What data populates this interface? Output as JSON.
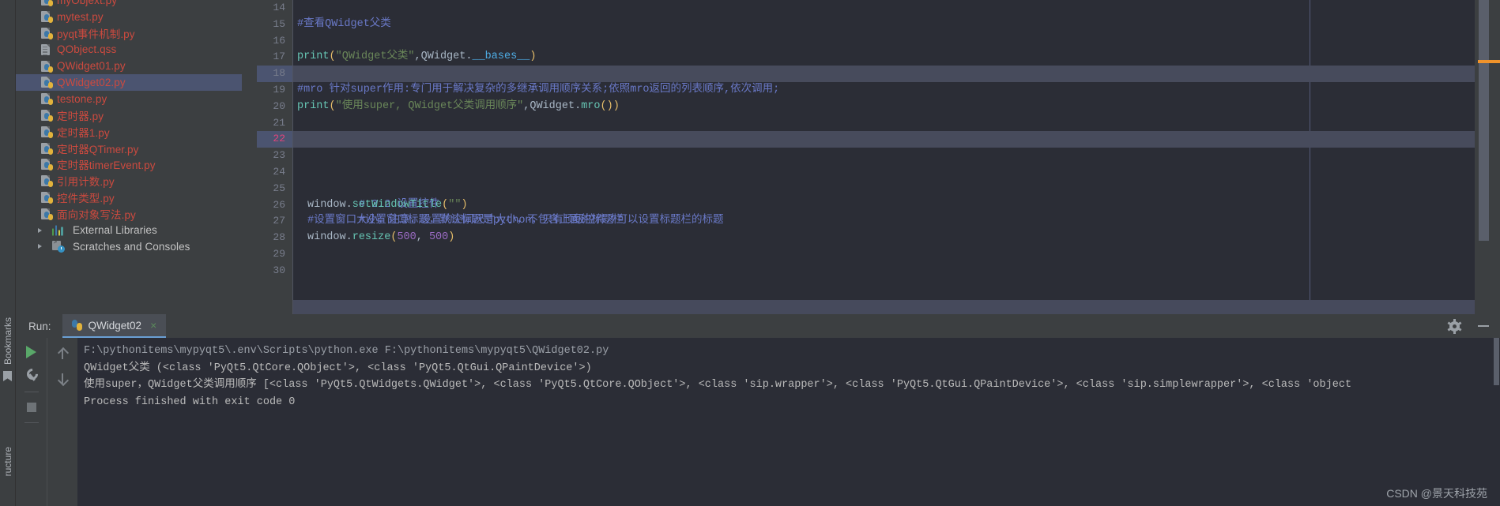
{
  "sidebar": {
    "files": [
      {
        "label": "myObjext.py",
        "icon": "python-file-icon",
        "type": "py",
        "selected": false,
        "partial": true
      },
      {
        "label": "mytest.py",
        "icon": "python-file-icon",
        "type": "py",
        "selected": false
      },
      {
        "label": "pyqt事件机制.py",
        "icon": "python-file-icon",
        "type": "py",
        "selected": false
      },
      {
        "label": "QObject.qss",
        "icon": "qss-file-icon",
        "type": "qss",
        "selected": false
      },
      {
        "label": "QWidget01.py",
        "icon": "python-file-icon",
        "type": "py",
        "selected": false
      },
      {
        "label": "QWidget02.py",
        "icon": "python-file-icon",
        "type": "py",
        "selected": true
      },
      {
        "label": "testone.py",
        "icon": "python-file-icon",
        "type": "py",
        "selected": false
      },
      {
        "label": "定时器.py",
        "icon": "python-file-icon",
        "type": "py",
        "selected": false
      },
      {
        "label": "定时器1.py",
        "icon": "python-file-icon",
        "type": "py",
        "selected": false
      },
      {
        "label": "定时器QTimer.py",
        "icon": "python-file-icon",
        "type": "py",
        "selected": false
      },
      {
        "label": "定时器timerEvent.py",
        "icon": "python-file-icon",
        "type": "py",
        "selected": false
      },
      {
        "label": "引用计数.py",
        "icon": "python-file-icon",
        "type": "py",
        "selected": false
      },
      {
        "label": "控件类型.py",
        "icon": "python-file-icon",
        "type": "py",
        "selected": false
      },
      {
        "label": "面向对象写法.py",
        "icon": "python-file-icon",
        "type": "py",
        "selected": false
      }
    ],
    "nodes": [
      {
        "label": "External Libraries",
        "icon": "libraries-icon"
      },
      {
        "label": "Scratches and Consoles",
        "icon": "scratches-icon"
      }
    ]
  },
  "editor": {
    "line_numbers": [
      "14",
      "15",
      "16",
      "17",
      "18",
      "19",
      "20",
      "21",
      "22",
      "23",
      "24",
      "25",
      "26",
      "27",
      "28",
      "29",
      "30"
    ],
    "current_line": "22",
    "highlighted_lines": [
      "18",
      "22"
    ],
    "lines": [
      {
        "n": "14",
        "text": ""
      },
      {
        "n": "15",
        "text": "#查看QWidget父类"
      },
      {
        "n": "16",
        "text": ""
      },
      {
        "n": "17",
        "text": "print(\"QWidget父类\",QWidget.__bases__)"
      },
      {
        "n": "18",
        "text": ""
      },
      {
        "n": "19",
        "text": "#mro 针对super作用:专门用于解决复杂的多继承调用顺序关系;依照mro返回的列表顺序,依次调用;"
      },
      {
        "n": "20",
        "text": "print(\"使用super, QWidget父类调用顺序\",QWidget.mro())"
      },
      {
        "n": "21",
        "text": ""
      },
      {
        "n": "22",
        "text": ""
      },
      {
        "n": "23",
        "text": ""
      },
      {
        "n": "24",
        "text": "# 2.2 设置控件"
      },
      {
        "n": "25",
        "text": "#设置窗口标题，默认标题是python，只有顶级控件才可以设置标题栏的标题"
      },
      {
        "n": "26",
        "text": "window.setWindowTitle(\"\")"
      },
      {
        "n": "27",
        "text": "#设置窗口大小，注意，设置的空间尺寸大小，不包含上面的标题栏"
      },
      {
        "n": "28",
        "text": "window.resize(500, 500)"
      },
      {
        "n": "29",
        "text": ""
      },
      {
        "n": "30",
        "text": ""
      }
    ],
    "code_tokens": {
      "l15_comment": "#查看QWidget父类",
      "l17_fn": "print",
      "l17_str": "\"QWidget父类\"",
      "l17_obj": "QWidget",
      "l17_attr": "__bases__",
      "l19_comment": "#mro 针对super作用:专门用于解决复杂的多继承调用顺序关系;依照mro返回的列表顺序,依次调用;",
      "l20_fn": "print",
      "l20_str": "\"使用super, QWidget父类调用顺序\"",
      "l20_obj": "QWidget",
      "l20_meth": "mro",
      "l24_comment": "# 2.2 设置控件",
      "l25_comment": "#设置窗口标题，默认标题是python，只有顶级控件才可以设置标题栏的标题",
      "l26_obj": "window",
      "l26_meth": "setWindowTitle",
      "l26_str": "\"\"",
      "l27_comment": "#设置窗口大小，注意，设置的空间尺寸大小，不包含上面的标题栏",
      "l28_obj": "window",
      "l28_meth": "resize",
      "l28_num1": "500",
      "l28_num2": "500"
    },
    "colors": {
      "background": "#2b2d36",
      "gutter": "#3c3f41",
      "comment": "#6a79c8",
      "string": "#6a8759",
      "number": "#9b6bc4",
      "function": "#66c4b3",
      "attribute": "#4eade5",
      "paren": "#e8bf6a",
      "current_line_number": "#e0457b",
      "selection": "#4b5470",
      "scroll_marker": "#f0932b"
    }
  },
  "run_panel": {
    "label": "Run:",
    "tab": {
      "name": "QWidget02",
      "icon": "python-file-icon",
      "close": "×"
    },
    "header_icons": [
      {
        "name": "settings-gear-icon"
      },
      {
        "name": "minimize-icon"
      }
    ],
    "tools": [
      {
        "name": "rerun-button",
        "icon": "play-icon"
      },
      {
        "name": "edit-configurations",
        "icon": "wrench-icon"
      },
      {
        "name": "stop-button",
        "icon": "stop-icon"
      },
      {
        "name": "up-stacktrace-button",
        "icon": "arrow-up-icon"
      },
      {
        "name": "down-stacktrace-button",
        "icon": "arrow-down-icon"
      },
      {
        "name": "soft-wrap-button",
        "icon": "wrap-icon"
      },
      {
        "name": "scroll-to-end-button",
        "icon": "scroll-end-icon"
      }
    ],
    "console_lines": [
      "F:\\pythonitems\\mypyqt5\\.env\\Scripts\\python.exe F:\\pythonitems\\mypyqt5\\QWidget02.py",
      "QWidget父类 (<class 'PyQt5.QtCore.QObject'>, <class 'PyQt5.QtGui.QPaintDevice'>)",
      "使用super，QWidget父类调用顺序 [<class 'PyQt5.QtWidgets.QWidget'>, <class 'PyQt5.QtCore.QObject'>, <class 'sip.wrapper'>, <class 'PyQt5.QtGui.QPaintDevice'>, <class 'sip.simplewrapper'>, <class 'object",
      "",
      "Process finished with exit code 0"
    ]
  },
  "rails": {
    "bookmarks": "Bookmarks",
    "structure": "ructure"
  },
  "watermark": "CSDN @景天科技苑"
}
